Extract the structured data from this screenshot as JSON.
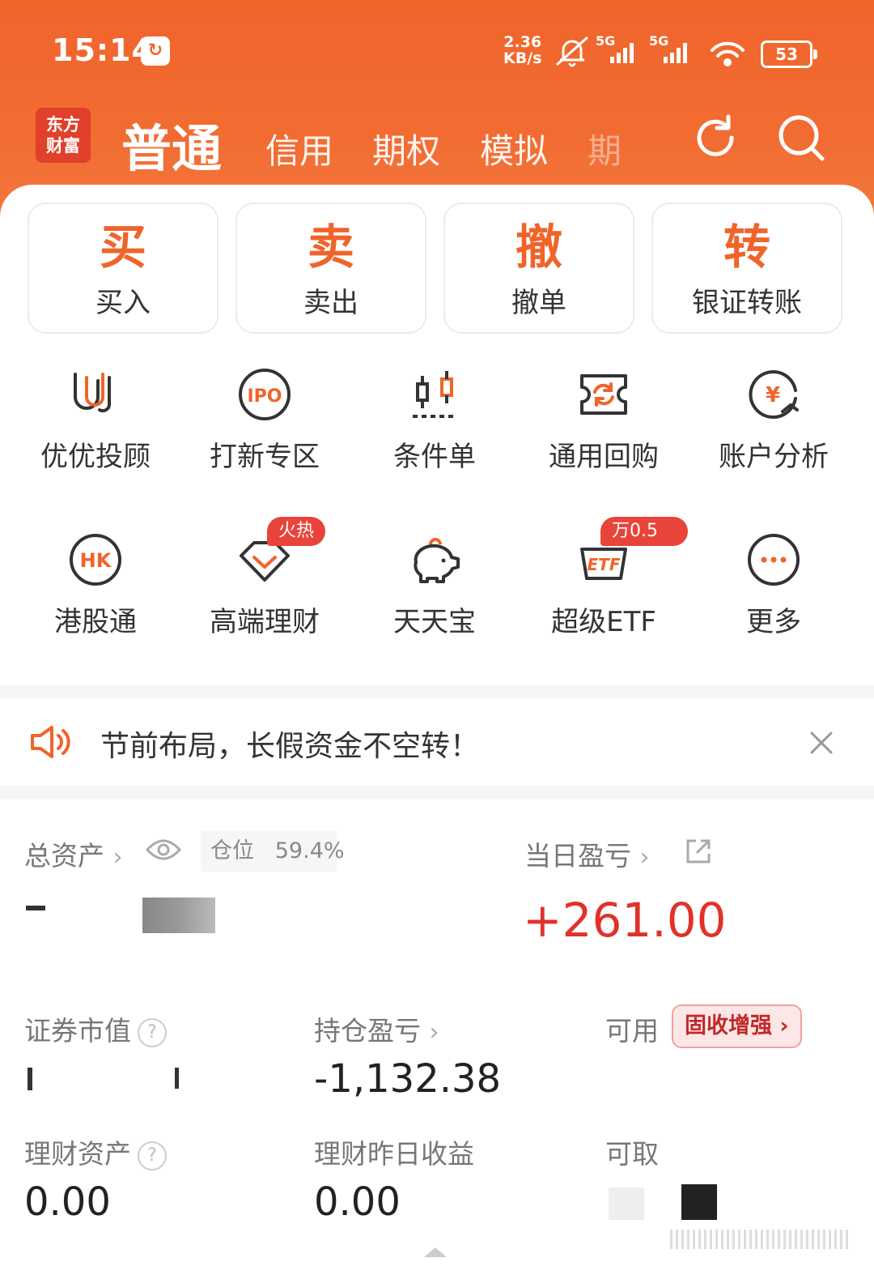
{
  "status_bar": {
    "time": "15:14",
    "net_speed_value": "2.36",
    "net_speed_unit": "KB/s",
    "signal_label_1": "5G",
    "signal_label_2": "5G",
    "battery": "53"
  },
  "header": {
    "logo_line1": "东方",
    "logo_line2": "财富",
    "tabs": [
      "普通",
      "信用",
      "期权",
      "模拟",
      "期"
    ],
    "active_tab": "普通"
  },
  "quick_actions": [
    {
      "big": "买",
      "label": "买入"
    },
    {
      "big": "卖",
      "label": "卖出"
    },
    {
      "big": "撤",
      "label": "撤单"
    },
    {
      "big": "转",
      "label": "银证转账"
    }
  ],
  "grid_row1": [
    {
      "label": "优优投顾",
      "icon": "uu-advisor-icon"
    },
    {
      "label": "打新专区",
      "icon": "ipo-icon"
    },
    {
      "label": "条件单",
      "icon": "candlestick-icon"
    },
    {
      "label": "通用回购",
      "icon": "repurchase-icon"
    },
    {
      "label": "账户分析",
      "icon": "yen-analysis-icon"
    }
  ],
  "grid_row2": [
    {
      "label": "港股通",
      "icon": "hk-icon"
    },
    {
      "label": "高端理财",
      "icon": "diamond-icon",
      "badge": "火热"
    },
    {
      "label": "天天宝",
      "icon": "piggy-bank-icon"
    },
    {
      "label": "超级ETF",
      "icon": "etf-icon",
      "badge": "万0.5"
    },
    {
      "label": "更多",
      "icon": "more-icon"
    }
  ],
  "notice": {
    "text": "节前布局，长假资金不空转！"
  },
  "assets": {
    "total_label": "总资产",
    "position_label": "仓位",
    "position_value": "59.4%",
    "daily_pnl_label": "当日盈亏",
    "daily_pnl_value": "+261.00",
    "market_value_label": "证券市值",
    "holding_pnl_label": "持仓盈亏",
    "holding_pnl_value": "-1,132.38",
    "available_label": "可用",
    "promo_label": "固收增强",
    "wealth_label": "理财资产",
    "wealth_value": "0.00",
    "wealth_yesterday_label": "理财昨日收益",
    "wealth_yesterday_value": "0.00",
    "withdrawable_label": "可取"
  },
  "colors": {
    "brand_orange": "#f0642a",
    "gain_red": "#e0322a",
    "loss_green": "#2ba84a"
  }
}
